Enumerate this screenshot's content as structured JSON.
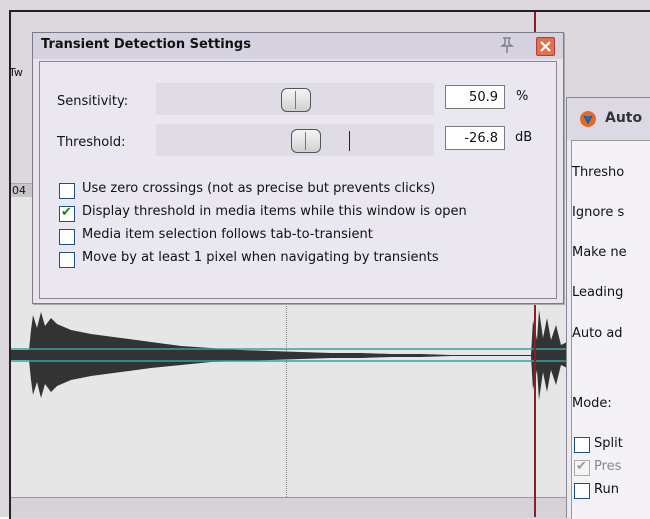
{
  "background": {
    "tab_label": "Tw",
    "ruler_number": "04"
  },
  "dialog": {
    "title": "Transient Detection Settings",
    "sensitivity": {
      "label": "Sensitivity:",
      "value": "50.9",
      "unit": "%",
      "level": 0.509
    },
    "threshold": {
      "label": "Threshold:",
      "value": "-26.8",
      "unit": "dB"
    },
    "options": [
      {
        "label": "Use zero crossings (not as precise but prevents clicks)",
        "checked": false
      },
      {
        "label": "Display threshold in media items while this window is open",
        "checked": true
      },
      {
        "label": "Media item selection follows tab-to-transient",
        "checked": false
      },
      {
        "label": "Move by at least 1 pixel when navigating by transients",
        "checked": false
      }
    ]
  },
  "right_panel": {
    "title": "Auto",
    "rows": [
      {
        "label": "Thresho"
      },
      {
        "label": "Ignore s"
      },
      {
        "label": "Make ne"
      },
      {
        "label": "Leading"
      },
      {
        "label": "Auto ad"
      },
      {
        "label": "Mode:"
      }
    ],
    "checkboxes": [
      {
        "label": "Split",
        "checked": false,
        "disabled": false
      },
      {
        "label": "Pres",
        "checked": true,
        "disabled": true
      },
      {
        "label": "Run",
        "checked": false,
        "disabled": false
      }
    ]
  },
  "colors": {
    "close_button": "#e07050",
    "checkmark": "#0a8a0a",
    "threshold_line": "#2fa6a6",
    "cursor": "#8a2020"
  },
  "icons": [
    "pin-icon",
    "close-icon",
    "checkmark-icon",
    "reaper-logo-icon"
  ]
}
